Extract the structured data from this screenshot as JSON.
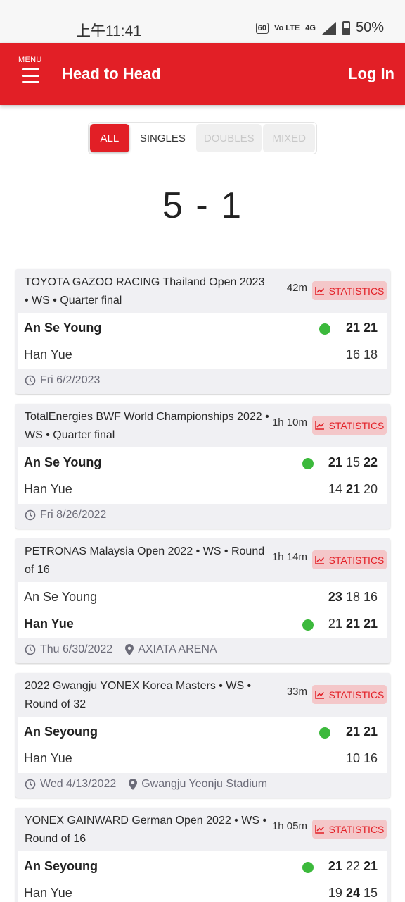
{
  "status_bar": {
    "time": "上午11:41",
    "hz": "60",
    "volte": "Vo LTE",
    "network": "4G",
    "battery": "50%"
  },
  "header": {
    "menu_label": "MENU",
    "title": "Head to Head",
    "login": "Log In"
  },
  "tabs": [
    "ALL",
    "SINGLES",
    "DOUBLES",
    "MIXED"
  ],
  "h2h_score": "5 - 1",
  "colors": {
    "brand_red": "#e21f26",
    "win_dot": "#3cb93c"
  },
  "stats_label": "STATISTICS",
  "matches": [
    {
      "event": "TOYOTA GAZOO RACING Thailand Open 2023 • WS • Quarter final",
      "duration": "42m",
      "p1": {
        "name": "An Se Young",
        "winner": true,
        "scores": [
          "21",
          "21"
        ],
        "won_sets": [
          true,
          true
        ]
      },
      "p2": {
        "name": "Han Yue",
        "winner": false,
        "scores": [
          "16",
          "18"
        ],
        "won_sets": [
          false,
          false
        ]
      },
      "date": "Fri 6/2/2023",
      "venue": ""
    },
    {
      "event": "TotalEnergies BWF World Championships 2022 • WS • Quarter final",
      "duration": "1h 10m",
      "p1": {
        "name": "An Se Young",
        "winner": true,
        "scores": [
          "21",
          "15",
          "22"
        ],
        "won_sets": [
          true,
          false,
          true
        ]
      },
      "p2": {
        "name": "Han Yue",
        "winner": false,
        "scores": [
          "14",
          "21",
          "20"
        ],
        "won_sets": [
          false,
          true,
          false
        ]
      },
      "date": "Fri 8/26/2022",
      "venue": ""
    },
    {
      "event": "PETRONAS Malaysia Open 2022 • WS • Round of 16",
      "duration": "1h 14m",
      "p1": {
        "name": "An Se Young",
        "winner": false,
        "scores": [
          "23",
          "18",
          "16"
        ],
        "won_sets": [
          true,
          false,
          false
        ]
      },
      "p2": {
        "name": "Han Yue",
        "winner": true,
        "scores": [
          "21",
          "21",
          "21"
        ],
        "won_sets": [
          false,
          true,
          true
        ]
      },
      "date": "Thu 6/30/2022",
      "venue": "AXIATA ARENA"
    },
    {
      "event": "2022 Gwangju YONEX Korea Masters • WS • Round of 32",
      "duration": "33m",
      "p1": {
        "name": "An Seyoung",
        "winner": true,
        "scores": [
          "21",
          "21"
        ],
        "won_sets": [
          true,
          true
        ]
      },
      "p2": {
        "name": "Han Yue",
        "winner": false,
        "scores": [
          "10",
          "16"
        ],
        "won_sets": [
          false,
          false
        ]
      },
      "date": "Wed 4/13/2022",
      "venue": "Gwangju Yeonju Stadium"
    },
    {
      "event": "YONEX GAINWARD German Open 2022 • WS • Round of 16",
      "duration": "1h 05m",
      "p1": {
        "name": "An Seyoung",
        "winner": true,
        "scores": [
          "21",
          "22",
          "21"
        ],
        "won_sets": [
          true,
          false,
          true
        ]
      },
      "p2": {
        "name": "Han Yue",
        "winner": false,
        "scores": [
          "19",
          "24",
          "15"
        ],
        "won_sets": [
          false,
          true,
          false
        ]
      },
      "date": "",
      "venue": ""
    }
  ]
}
